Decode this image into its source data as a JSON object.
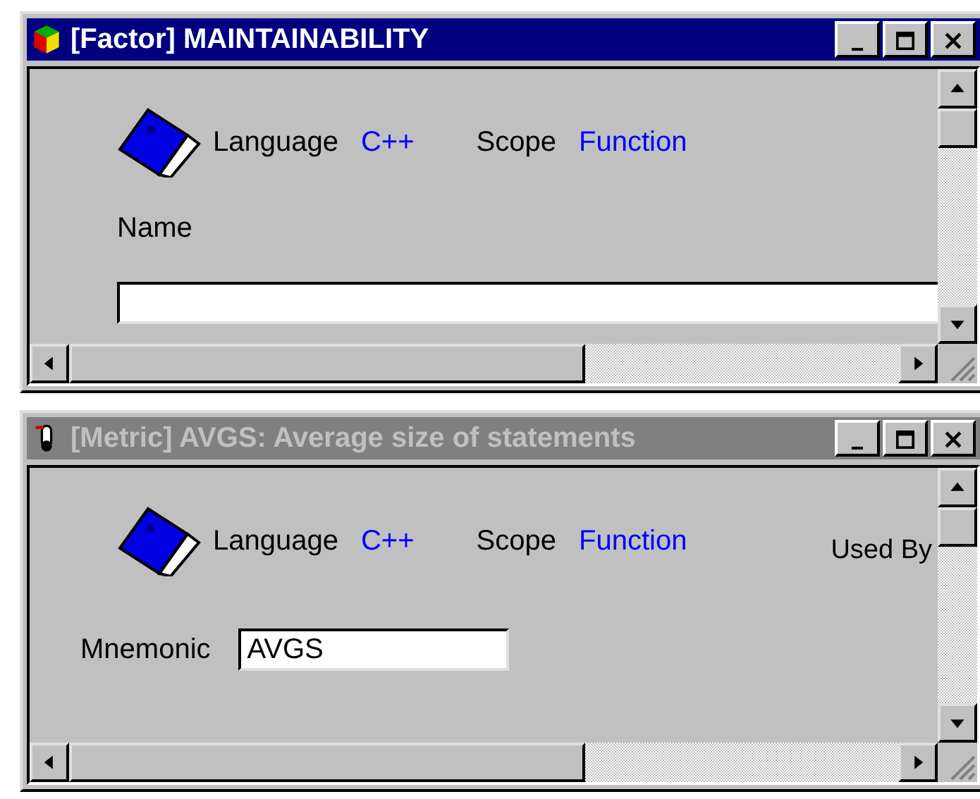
{
  "windows": [
    {
      "title": "[Factor] MAINTAINABILITY",
      "active": true,
      "language_label": "Language",
      "language": "C++",
      "scope_label": "Scope",
      "scope": "Function",
      "field": {
        "kind": "stacked",
        "label": "Name"
      }
    },
    {
      "title": "[Metric] AVGS: Average size of statements",
      "active": false,
      "language_label": "Language",
      "language": "C++",
      "scope_label": "Scope",
      "scope": "Function",
      "used_by_label": "Used By",
      "field": {
        "kind": "inline",
        "label": "Mnemonic",
        "value": "AVGS"
      }
    }
  ]
}
